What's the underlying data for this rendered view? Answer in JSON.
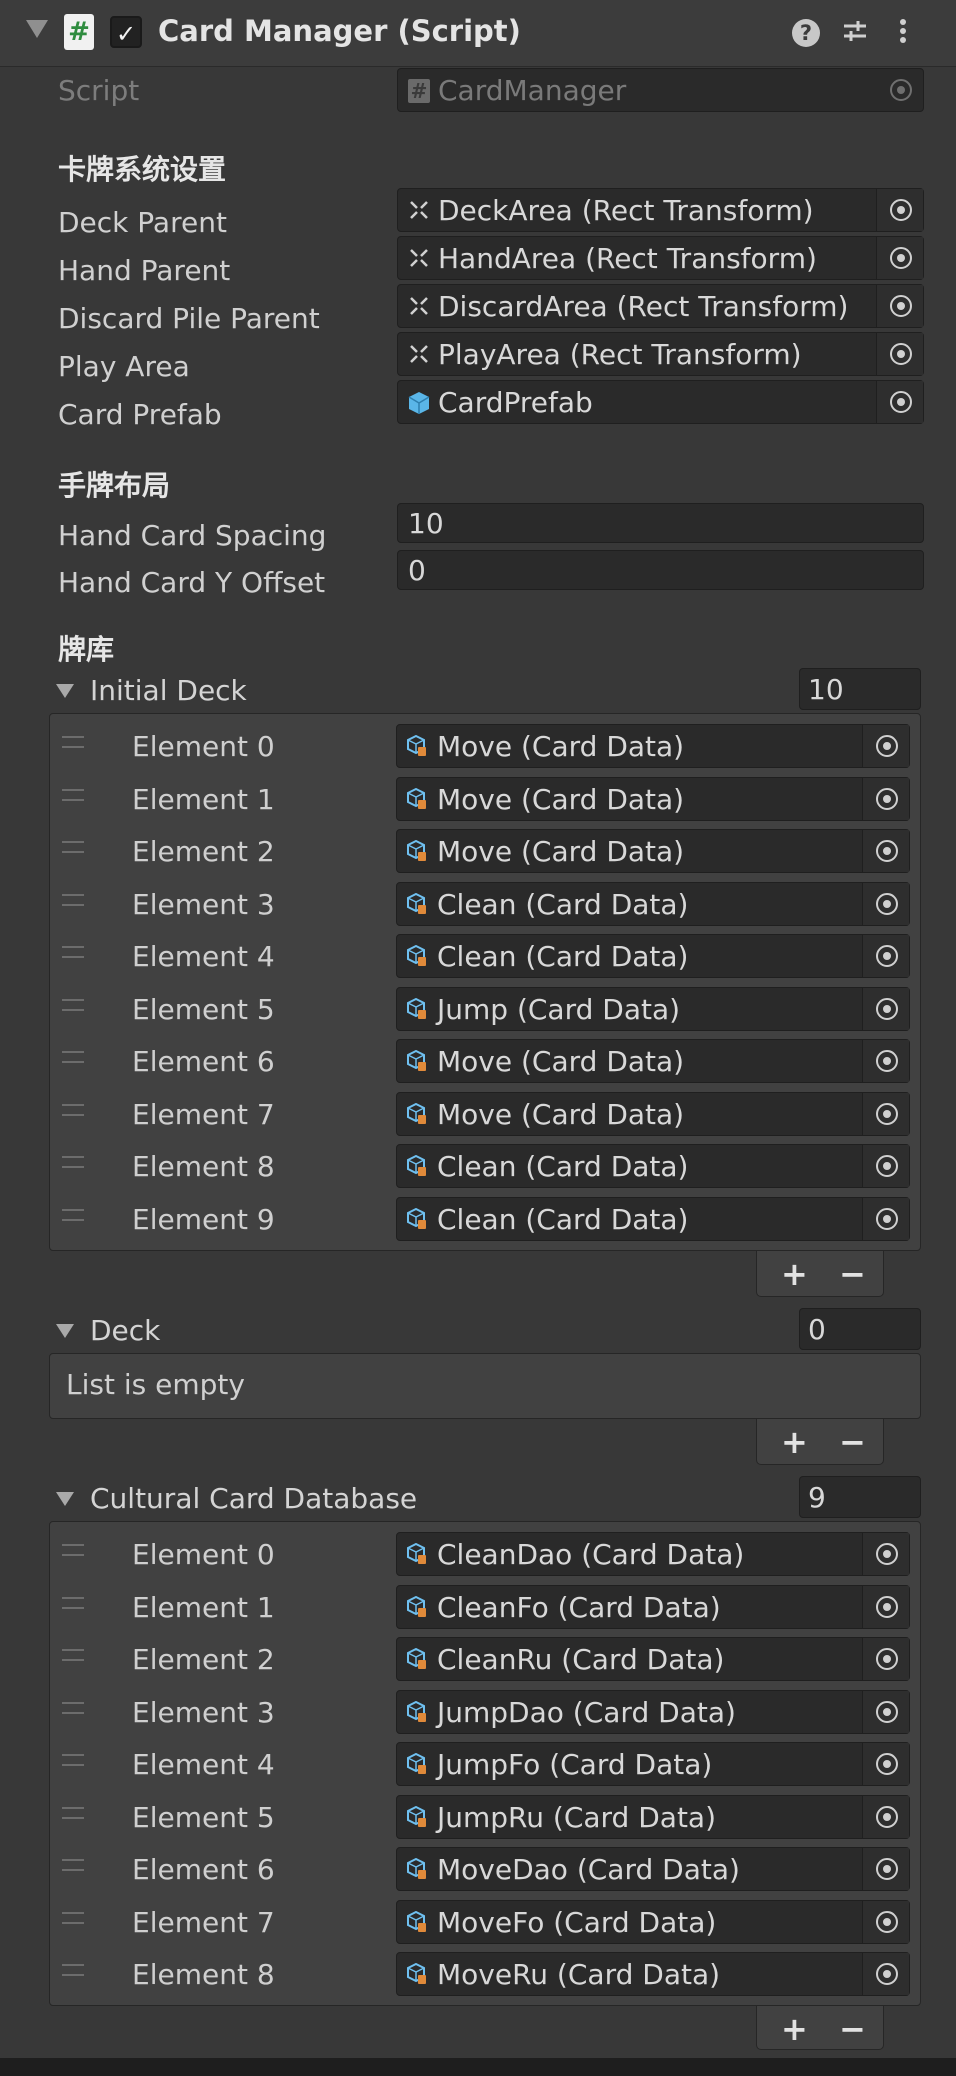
{
  "header": {
    "title": "Card Manager (Script)",
    "enabled": "✓"
  },
  "script_row": {
    "label": "Script",
    "value": "CardManager"
  },
  "sections": {
    "card_system": "卡牌系统设置",
    "hand_layout": "手牌布局",
    "deck": "牌库"
  },
  "card_system_fields": [
    {
      "label": "Deck Parent",
      "value": "DeckArea (Rect Transform)",
      "icon": "rect-transform-icon"
    },
    {
      "label": "Hand Parent",
      "value": "HandArea (Rect Transform)",
      "icon": "rect-transform-icon"
    },
    {
      "label": "Discard Pile Parent",
      "value": "DiscardArea (Rect Transform)",
      "icon": "rect-transform-icon"
    },
    {
      "label": "Play Area",
      "value": "PlayArea (Rect Transform)",
      "icon": "rect-transform-icon"
    },
    {
      "label": "Card Prefab",
      "value": "CardPrefab",
      "icon": "prefab-icon"
    }
  ],
  "hand_layout_fields": [
    {
      "label": "Hand Card Spacing",
      "value": "10"
    },
    {
      "label": "Hand Card Y Offset",
      "value": "0"
    }
  ],
  "initial_deck": {
    "label": "Initial Deck",
    "size": "10",
    "elements": [
      {
        "label": "Element 0",
        "value": "Move (Card Data)"
      },
      {
        "label": "Element 1",
        "value": "Move (Card Data)"
      },
      {
        "label": "Element 2",
        "value": "Move (Card Data)"
      },
      {
        "label": "Element 3",
        "value": "Clean (Card Data)"
      },
      {
        "label": "Element 4",
        "value": "Clean (Card Data)"
      },
      {
        "label": "Element 5",
        "value": "Jump (Card Data)"
      },
      {
        "label": "Element 6",
        "value": "Move (Card Data)"
      },
      {
        "label": "Element 7",
        "value": "Move (Card Data)"
      },
      {
        "label": "Element 8",
        "value": "Clean (Card Data)"
      },
      {
        "label": "Element 9",
        "value": "Clean (Card Data)"
      }
    ]
  },
  "deck": {
    "label": "Deck",
    "size": "0",
    "empty_text": "List is empty"
  },
  "cultural_db": {
    "label": "Cultural Card Database",
    "size": "9",
    "elements": [
      {
        "label": "Element 0",
        "value": "CleanDao (Card Data)"
      },
      {
        "label": "Element 1",
        "value": "CleanFo (Card Data)"
      },
      {
        "label": "Element 2",
        "value": "CleanRu (Card Data)"
      },
      {
        "label": "Element 3",
        "value": "JumpDao (Card Data)"
      },
      {
        "label": "Element 4",
        "value": "JumpFo (Card Data)"
      },
      {
        "label": "Element 5",
        "value": "JumpRu (Card Data)"
      },
      {
        "label": "Element 6",
        "value": "MoveDao (Card Data)"
      },
      {
        "label": "Element 7",
        "value": "MoveFo (Card Data)"
      },
      {
        "label": "Element 8",
        "value": "MoveRu (Card Data)"
      }
    ]
  },
  "list_buttons": {
    "add": "+",
    "remove": "−"
  },
  "colors": {
    "background": "#383838",
    "field": "#2a2a2a",
    "list_bg": "#414141",
    "script_icon_green": "#2f8c3f",
    "so_icon_blue": "#6fc0f0",
    "so_icon_orange": "#e08a3a"
  }
}
